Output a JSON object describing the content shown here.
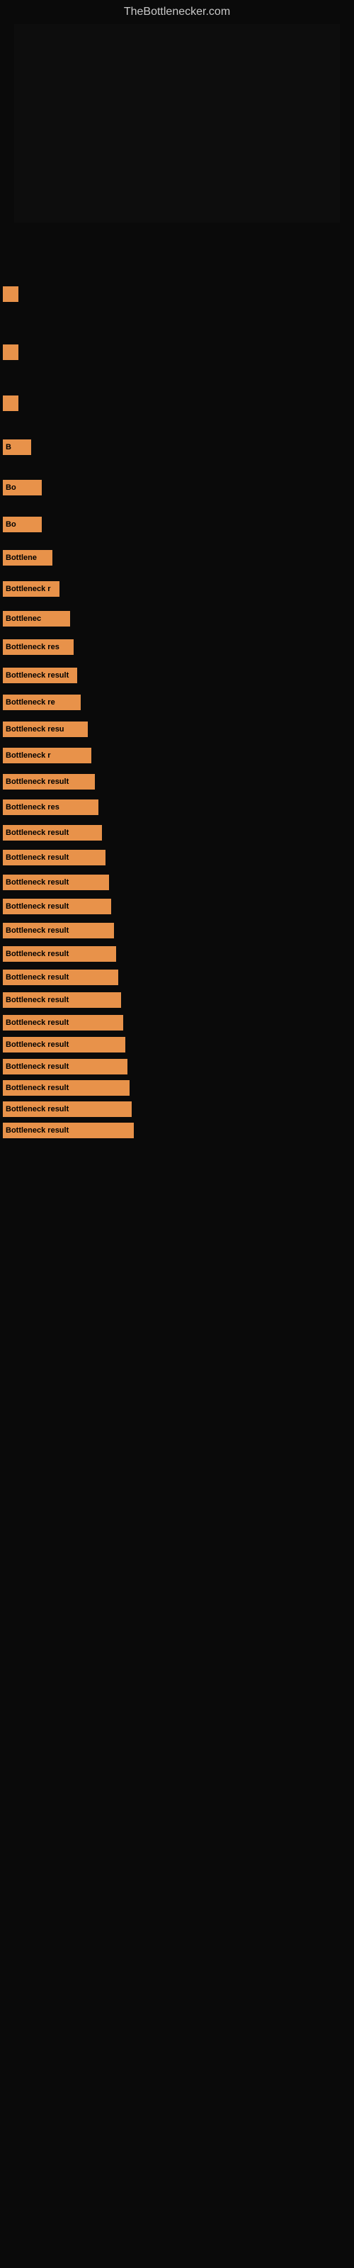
{
  "site": {
    "title": "TheBottlenecker.com"
  },
  "bars": [
    {
      "id": 1,
      "label": "",
      "width_class": "bar-1",
      "gap": "large"
    },
    {
      "id": 2,
      "label": "",
      "width_class": "bar-2",
      "gap": "large"
    },
    {
      "id": 3,
      "label": "",
      "width_class": "bar-3",
      "gap": "large"
    },
    {
      "id": 4,
      "label": "B",
      "width_class": "bar-4",
      "gap": "large"
    },
    {
      "id": 5,
      "label": "Bo",
      "width_class": "bar-5",
      "gap": "large"
    },
    {
      "id": 6,
      "label": "Bo",
      "width_class": "bar-6",
      "gap": "large"
    },
    {
      "id": 7,
      "label": "Bottlene",
      "width_class": "bar-7",
      "gap": "large"
    },
    {
      "id": 8,
      "label": "Bottleneck r",
      "width_class": "bar-8",
      "gap": "large"
    },
    {
      "id": 9,
      "label": "Bottlenec",
      "width_class": "bar-9",
      "gap": "large"
    },
    {
      "id": 10,
      "label": "Bottleneck res",
      "width_class": "bar-10",
      "gap": "large"
    },
    {
      "id": 11,
      "label": "Bottleneck result",
      "width_class": "bar-11",
      "gap": "large"
    },
    {
      "id": 12,
      "label": "Bottleneck re",
      "width_class": "bar-12",
      "gap": "large"
    },
    {
      "id": 13,
      "label": "Bottleneck resu",
      "width_class": "bar-13",
      "gap": "large"
    },
    {
      "id": 14,
      "label": "Bottleneck r",
      "width_class": "bar-14",
      "gap": "large"
    },
    {
      "id": 15,
      "label": "Bottleneck result",
      "width_class": "bar-15",
      "gap": "large"
    },
    {
      "id": 16,
      "label": "Bottleneck res",
      "width_class": "bar-16",
      "gap": "large"
    },
    {
      "id": 17,
      "label": "Bottleneck result",
      "width_class": "bar-17",
      "gap": "large"
    },
    {
      "id": 18,
      "label": "Bottleneck result",
      "width_class": "bar-18",
      "gap": "large"
    },
    {
      "id": 19,
      "label": "Bottleneck result",
      "width_class": "bar-19",
      "gap": "large"
    },
    {
      "id": 20,
      "label": "Bottleneck result",
      "width_class": "bar-20",
      "gap": "large"
    },
    {
      "id": 21,
      "label": "Bottleneck result",
      "width_class": "bar-21",
      "gap": "large"
    },
    {
      "id": 22,
      "label": "Bottleneck result",
      "width_class": "bar-22",
      "gap": "large"
    },
    {
      "id": 23,
      "label": "Bottleneck result",
      "width_class": "bar-23",
      "gap": "large"
    },
    {
      "id": 24,
      "label": "Bottleneck result",
      "width_class": "bar-24",
      "gap": "large"
    },
    {
      "id": 25,
      "label": "Bottleneck result",
      "width_class": "bar-25",
      "gap": "large"
    },
    {
      "id": 26,
      "label": "Bottleneck result",
      "width_class": "bar-26",
      "gap": "large"
    },
    {
      "id": 27,
      "label": "Bottleneck result",
      "width_class": "bar-27",
      "gap": "large"
    },
    {
      "id": 28,
      "label": "Bottleneck result",
      "width_class": "bar-28",
      "gap": "large"
    },
    {
      "id": 29,
      "label": "Bottleneck result",
      "width_class": "bar-29",
      "gap": "large"
    },
    {
      "id": 30,
      "label": "Bottleneck result",
      "width_class": "bar-30",
      "gap": "large"
    }
  ]
}
